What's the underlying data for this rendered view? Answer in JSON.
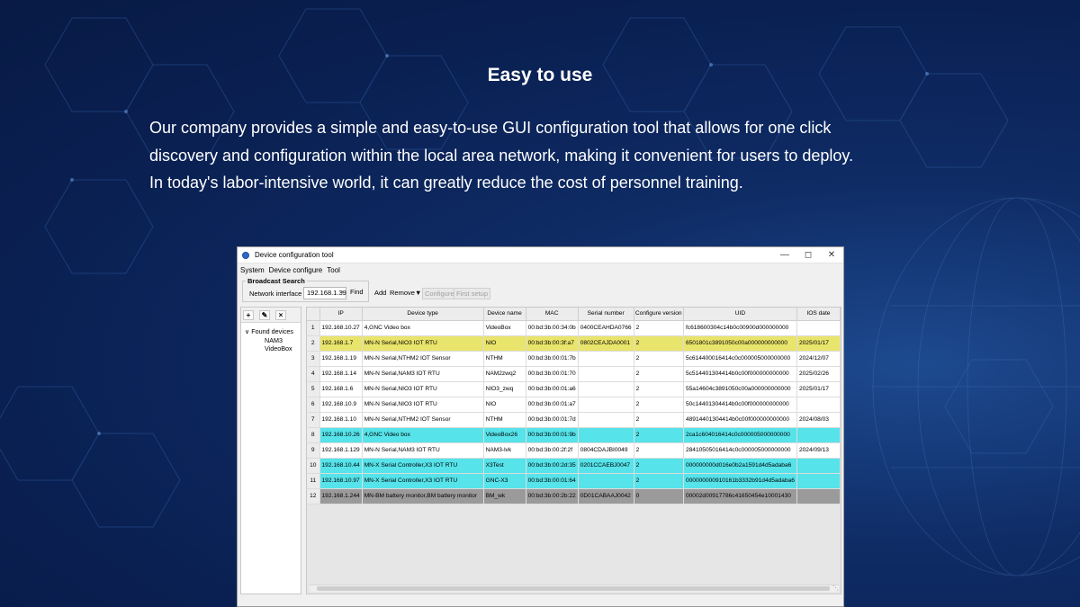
{
  "slide": {
    "headline": "Easy to use",
    "intro_lines": [
      "Our company provides a simple and easy-to-use GUI configuration tool that allows for one click",
      "discovery and configuration within the local area network, making it convenient for users to deploy.",
      "In today's labor-intensive world, it can greatly reduce the cost of personnel training."
    ]
  },
  "window": {
    "title": "Device configuration tool",
    "menu": [
      "System",
      "Device configure",
      "Tool"
    ],
    "broadcast_legend": "Broadcast Search",
    "network_interface_label": "Network interface",
    "ip_value": "192.168.1.39",
    "find_label": "Find",
    "add_label": "Add",
    "remove_label": "Remove",
    "configure_label": "Configure",
    "first_setup_label": "First setup",
    "tree": {
      "root": "Found devices",
      "children": [
        "NAM3",
        "VideoBox"
      ]
    },
    "columns": [
      "IP",
      "Device type",
      "Device name",
      "MAC",
      "Serial number",
      "Configure version",
      "UID",
      "IOS date"
    ],
    "rows": [
      {
        "n": "1",
        "hl": "",
        "cells": [
          "192.168.10.27",
          "4,GNC Video box",
          "VideoBox",
          "00:bd:3b:00:34:0b",
          "0400CEAHDA0766",
          "2",
          "fc618600304c14b0c00900d000000000",
          ""
        ]
      },
      {
        "n": "2",
        "hl": "yellow",
        "cells": [
          "192.168.1.7",
          "MN-N Serial,NIO3 IOT RTU",
          "NIO",
          "00:bd:3b:00:3f:a7",
          "0802CEAJDA0001",
          "2",
          "6501801c3891050c00a000000000000",
          "2025/01/17"
        ]
      },
      {
        "n": "3",
        "hl": "",
        "cells": [
          "192.168.1.19",
          "MN-N Serial,NTHM2 IOT Sensor",
          "NTHM",
          "00:bd:3b:00:01:7b",
          "",
          "2",
          "5c614400016414c0c000005000000000",
          "2024/12/07"
        ]
      },
      {
        "n": "4",
        "hl": "",
        "cells": [
          "192.168.1.14",
          "MN-N Serial,NAM3 IOT RTU",
          "NAM2zwq2",
          "00:bd:3b:00:01:70",
          "",
          "2",
          "5c514401304414b0c00f000000000000",
          "2025/02/26"
        ]
      },
      {
        "n": "5",
        "hl": "",
        "cells": [
          "192.168.1.6",
          "MN-N Serial,NIO3 IOT RTU",
          "NIO3_zwq",
          "00:bd:3b:00:01:a6",
          "",
          "2",
          "55a14604c3891050c00a000000000000",
          "2025/01/17"
        ]
      },
      {
        "n": "6",
        "hl": "",
        "cells": [
          "192.168.10.9",
          "MN-N Serial,NIO3 IOT RTU",
          "NIO",
          "00:bd:3b:00:01:a7",
          "",
          "2",
          "50c14401304414b0c00f000000000000",
          ""
        ]
      },
      {
        "n": "7",
        "hl": "",
        "cells": [
          "192.168.1.10",
          "MN-N Serial,NTHM2 IOT Sensor",
          "NTHM",
          "00:bd:3b:00:01:7d",
          "",
          "2",
          "48914401304414b0c00f000000000000",
          "2024/08/03"
        ]
      },
      {
        "n": "8",
        "hl": "cyan",
        "cells": [
          "192.168.10.26",
          "4,GNC Video box",
          "VideoBox26",
          "00:bd:3b:00:01:9b",
          "",
          "2",
          "2ca1c604016414c0c000005000000000",
          ""
        ]
      },
      {
        "n": "9",
        "hl": "",
        "cells": [
          "192.168.1.129",
          "MN-N Serial,NAM3 IOT RTU",
          "NAM3-lvk",
          "00:bd:3b:00:2f:2f",
          "0804CDAJBI0049",
          "2",
          "28410505016414c0c000005000000000",
          "2024/09/13"
        ]
      },
      {
        "n": "10",
        "hl": "cyan",
        "cells": [
          "192.168.10.44",
          "MN-X Serial Controller,X3 IOT RTU",
          "X3Test",
          "00:bd:3b:00:2d:35",
          "0201CCAEBJ0047",
          "2",
          "000000000d016e0b2a1591d4d5adaba6",
          ""
        ]
      },
      {
        "n": "11",
        "hl": "cyan",
        "cells": [
          "192.168.10.97",
          "MN-X Serial Controller,X3 IOT RTU",
          "GNC-X3",
          "00:bd:3b:00:01:64",
          "",
          "2",
          "000000000910161b3332b91d4d5adaba6",
          ""
        ]
      },
      {
        "n": "12",
        "hl": "gray",
        "cells": [
          "192.168.1.244",
          "MN-BM battery monitor,BM battery monitor",
          "BM_wk",
          "00:bd:3b:00:2b:22",
          "0D01CABAAJ0042",
          "0",
          "00002d00917786c41650454e10001430",
          ""
        ]
      }
    ]
  },
  "colors": {
    "bg": "#0a2052",
    "yellow_row": "#e9e46b",
    "cyan_row": "#56e3ea",
    "gray_row": "#9a9a9a"
  }
}
